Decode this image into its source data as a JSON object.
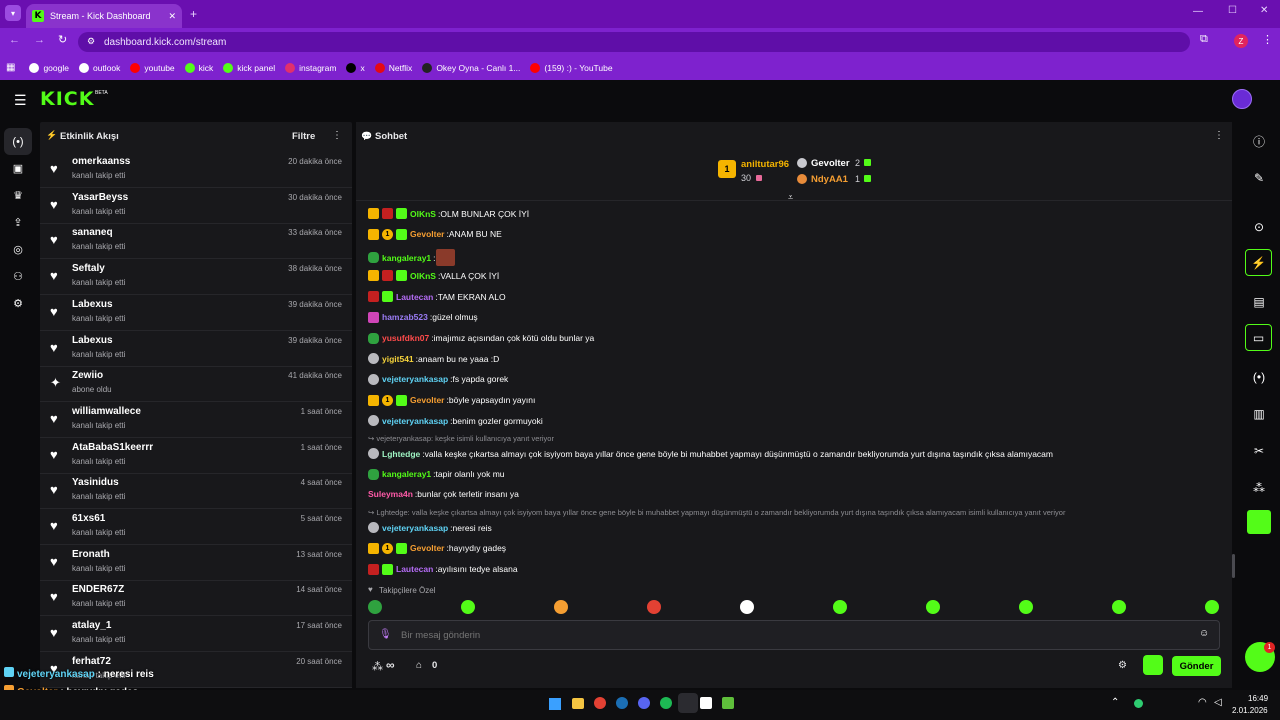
{
  "browser": {
    "tab_title": "Stream - Kick Dashboard",
    "url": "dashboard.kick.com/stream",
    "profile_initial": "Z",
    "bookmarks": [
      {
        "label": "google",
        "color": "#ffffff"
      },
      {
        "label": "outlook",
        "color": "#ffffff"
      },
      {
        "label": "youtube",
        "color": "#ff0000"
      },
      {
        "label": "kick",
        "color": "#53fc18"
      },
      {
        "label": "kick panel",
        "color": "#53fc18"
      },
      {
        "label": "instagram",
        "color": "#e1306c"
      },
      {
        "label": "x",
        "color": "#000000"
      },
      {
        "label": "Netflix",
        "color": "#e50914"
      },
      {
        "label": "Okey Oyna - Canlı 1...",
        "color": "#222222"
      },
      {
        "label": "(159) :) - YouTube",
        "color": "#ff0000"
      }
    ]
  },
  "app": {
    "logo": "KICK",
    "logo_badge": "BETA"
  },
  "activity": {
    "title": "Etkinlik Akışı",
    "filter_label": "Filtre",
    "items": [
      {
        "name": "omerkaanss",
        "action": "kanalı takip etti",
        "time": "20 dakika önce",
        "icon": "heart-icon"
      },
      {
        "name": "YasarBeyss",
        "action": "kanalı takip etti",
        "time": "30 dakika önce",
        "icon": "heart-icon"
      },
      {
        "name": "sananeq",
        "action": "kanalı takip etti",
        "time": "33 dakika önce",
        "icon": "heart-icon"
      },
      {
        "name": "Seftaly",
        "action": "kanalı takip etti",
        "time": "38 dakika önce",
        "icon": "heart-icon"
      },
      {
        "name": "Labexus",
        "action": "kanalı takip etti",
        "time": "39 dakika önce",
        "icon": "heart-icon"
      },
      {
        "name": "Labexus",
        "action": "kanalı takip etti",
        "time": "39 dakika önce",
        "icon": "heart-icon"
      },
      {
        "name": "Zewiio",
        "action": "abone oldu",
        "time": "41 dakika önce",
        "icon": "sparkle-icon"
      },
      {
        "name": "williamwallece",
        "action": "kanalı takip etti",
        "time": "1 saat önce",
        "icon": "heart-icon"
      },
      {
        "name": "AtaBabaS1keerrr",
        "action": "kanalı takip etti",
        "time": "1 saat önce",
        "icon": "heart-icon"
      },
      {
        "name": "Yasinidus",
        "action": "kanalı takip etti",
        "time": "4 saat önce",
        "icon": "heart-icon"
      },
      {
        "name": "61xs61",
        "action": "kanalı takip etti",
        "time": "5 saat önce",
        "icon": "heart-icon"
      },
      {
        "name": "Eronath",
        "action": "kanalı takip etti",
        "time": "13 saat önce",
        "icon": "heart-icon"
      },
      {
        "name": "ENDER67Z",
        "action": "kanalı takip etti",
        "time": "14 saat önce",
        "icon": "heart-icon"
      },
      {
        "name": "atalay_1",
        "action": "kanalı takip etti",
        "time": "17 saat önce",
        "icon": "heart-icon"
      },
      {
        "name": "ferhat72",
        "action": "kanalı takip etti",
        "time": "20 saat önce",
        "icon": "heart-icon"
      }
    ]
  },
  "chat": {
    "title": "Sohbet",
    "leaderboard": {
      "first": {
        "name": "aniltutar96",
        "rank": "1",
        "count": "30"
      },
      "second": {
        "name": "Gevolter",
        "count": "2"
      },
      "third": {
        "name": "NdyAA1",
        "count": "1"
      }
    },
    "messages": [
      {
        "badges": [
          "crown",
          "red",
          "gift"
        ],
        "user": "OlKnS",
        "color": "#53fc18",
        "text": "OLM BUNLAR ÇOK İYİ"
      },
      {
        "badges": [
          "crown",
          "one",
          "gift"
        ],
        "user": "Gevolter",
        "color": "#f59e32",
        "text": "ANAM BU NE"
      },
      {
        "badges": [
          "frog"
        ],
        "user": "kangaleray1",
        "color": "#53fc18",
        "text": "",
        "emote": true
      },
      {
        "badges": [
          "crown",
          "red",
          "gift"
        ],
        "user": "OlKnS",
        "color": "#53fc18",
        "text": "VALLA ÇOK İYİ"
      },
      {
        "badges": [
          "red",
          "gift"
        ],
        "user": "Lautecan",
        "color": "#b46cf5",
        "text": "TAM EKRAN ALO"
      },
      {
        "badges": [
          "pink"
        ],
        "user": "hamzab523",
        "color": "#9b7cf5",
        "text": "güzel olmuş"
      },
      {
        "badges": [
          "frog"
        ],
        "user": "yusufdkn07",
        "color": "#ff4b4b",
        "text": "imajımız açısından çok kötü oldu bunlar ya"
      },
      {
        "badges": [
          "grey"
        ],
        "user": "yigit541",
        "color": "#f5d33b",
        "text": "anaam bu ne yaaa :D"
      },
      {
        "badges": [
          "grey"
        ],
        "user": "vejeteryankasap",
        "color": "#5fd3f5",
        "text": "fs yapda gorek"
      },
      {
        "badges": [
          "crown",
          "one",
          "gift"
        ],
        "user": "Gevolter",
        "color": "#f59e32",
        "text": "böyle yapsaydın yayını"
      },
      {
        "badges": [
          "grey"
        ],
        "user": "vejeteryankasap",
        "color": "#5fd3f5",
        "text": "benim gozler gormuyoki"
      },
      {
        "reply": "vejeteryankasap: keşke isimli kullanıcıya yanıt veriyor"
      },
      {
        "badges": [
          "grey"
        ],
        "user": "Lghtedge",
        "color": "#9ff5c4",
        "text": "valla keşke çıkartsa almayı çok isyiyom baya yıllar önce gene böyle bi muhabbet yapmayı düşünmüştü o zamandır bekliyorumda yurt dışına taşındık çıksa alamıyacam"
      },
      {
        "badges": [
          "frog"
        ],
        "user": "kangaleray1",
        "color": "#53fc18",
        "text": "tapir olanlı yok mu"
      },
      {
        "badges": [],
        "user": "Suleyma4n",
        "color": "#ff5aa8",
        "text": "bunlar çok terletir insanı ya"
      },
      {
        "reply": "Lghtedge: valla keşke çıkartsa almayı çok isyiyom baya yıllar önce gene böyle bi muhabbet yapmayı düşünmüştü o zamandır bekliyorumda yurt dışına taşındık çıksa alamıyacam isimli kullanıcıya yanıt veriyor"
      },
      {
        "badges": [
          "grey"
        ],
        "user": "vejeteryankasap",
        "color": "#5fd3f5",
        "text": "neresi reis"
      },
      {
        "badges": [
          "crown",
          "one",
          "gift"
        ],
        "user": "Gevolter",
        "color": "#f59e32",
        "text": "hayıydıy gadeş"
      },
      {
        "badges": [
          "red",
          "gift"
        ],
        "user": "Lautecan",
        "color": "#b46cf5",
        "text": "ayılısını tedye alsana"
      }
    ],
    "followers_only": "Takipçilere Özel",
    "input_placeholder": "Bir mesaj gönderin",
    "points_value": "∞",
    "store_count": "0",
    "send_label": "Gönder",
    "notification_count": "1"
  },
  "overlay": [
    {
      "user": "vejeteryankasap",
      "color": "#5fd3f5",
      "text": "neresi reis"
    },
    {
      "user": "Gevolter",
      "color": "#f59e32",
      "text": "hayıydıy gadeş"
    },
    {
      "user": "Lautecan",
      "color": "#b46cf5",
      "text": "ayılısını tedye alsana"
    }
  ],
  "taskbar": {
    "time": "16:49",
    "date": "2.01.2026"
  }
}
